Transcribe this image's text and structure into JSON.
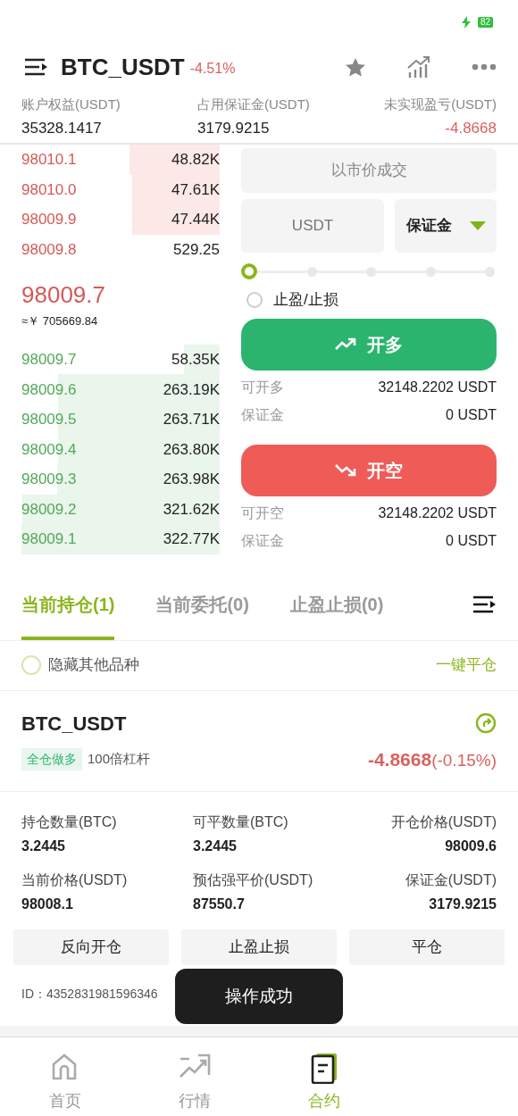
{
  "status_bar": {
    "battery": "82",
    "charging": true
  },
  "header": {
    "symbol": "BTC_USDT",
    "change": "-4.51%",
    "favorite": false
  },
  "account": [
    {
      "label": "账户权益(USDT)",
      "value": "35328.1417",
      "kind": "plain"
    },
    {
      "label": "占用保证金(USDT)",
      "value": "3179.9215",
      "kind": "plain"
    },
    {
      "label": "未实现盈亏(USDT)",
      "value": "-4.8668",
      "kind": "loss"
    }
  ],
  "asks": [
    {
      "price": "98010.1",
      "amount": "48.82K"
    },
    {
      "price": "98010.0",
      "amount": "47.61K"
    },
    {
      "price": "98009.9",
      "amount": "47.44K"
    },
    {
      "price": "98009.8",
      "amount": "529.25"
    }
  ],
  "last_price": "98009.7",
  "last_price_cny": "≈￥ 705669.84",
  "bids": [
    {
      "price": "98009.7",
      "amount": "58.35K"
    },
    {
      "price": "98009.6",
      "amount": "263.19K"
    },
    {
      "price": "98009.5",
      "amount": "263.71K"
    },
    {
      "price": "98009.4",
      "amount": "263.80K"
    },
    {
      "price": "98009.3",
      "amount": "263.98K"
    },
    {
      "price": "98009.2",
      "amount": "321.62K"
    },
    {
      "price": "98009.1",
      "amount": "322.77K"
    }
  ],
  "order_form": {
    "price_mode": "以市价成交",
    "amount_placeholder": "USDT",
    "amount_unit": "保证金",
    "slider": {
      "stops": [
        {
          "selected": true
        },
        {
          "selected": false
        },
        {
          "selected": false
        },
        {
          "selected": false
        },
        {
          "selected": false
        }
      ]
    },
    "tp_sl": {
      "label": "止盈/止损",
      "checked": false
    },
    "actions": [
      {
        "kind": "long",
        "label": "开多",
        "lines": [
          {
            "label": "可开多",
            "value": "32148.2202 USDT"
          },
          {
            "label": "保证金",
            "value": "0 USDT"
          }
        ]
      },
      {
        "kind": "short",
        "label": "开空",
        "lines": [
          {
            "label": "可开空",
            "value": "32148.2202 USDT"
          },
          {
            "label": "保证金",
            "value": "0 USDT"
          }
        ]
      }
    ]
  },
  "tabs": [
    {
      "label": "当前持仓(1)",
      "selected": true
    },
    {
      "label": "当前委托(0)",
      "selected": false
    },
    {
      "label": "止盈止损(0)",
      "selected": false
    }
  ],
  "hide_others": {
    "label": "隐藏其他品种",
    "checked": false
  },
  "close_all": "一键平仓",
  "position": {
    "symbol": "BTC_USDT",
    "tag": "全仓做多",
    "leverage": "100倍杠杆",
    "pnl": "-4.8668",
    "pnl_pct": "(-0.15%)",
    "fields": [
      {
        "label": "持仓数量(BTC)",
        "value": "3.2445"
      },
      {
        "label": "可平数量(BTC)",
        "value": "3.2445"
      },
      {
        "label": "开仓价格(USDT)",
        "value": "98009.6"
      },
      {
        "label": "当前价格(USDT)",
        "value": "98008.1"
      },
      {
        "label": "预估强平价(USDT)",
        "value": "87550.7"
      },
      {
        "label": "保证金(USDT)",
        "value": "3179.9215"
      }
    ],
    "buttons": [
      "反向开仓",
      "止盈止损",
      "平仓"
    ],
    "id": "ID：4352831981596346"
  },
  "toast": "操作成功",
  "bottom_nav": [
    {
      "label": "首页",
      "selected": false
    },
    {
      "label": "行情",
      "selected": false
    },
    {
      "label": "合约",
      "selected": true
    }
  ]
}
